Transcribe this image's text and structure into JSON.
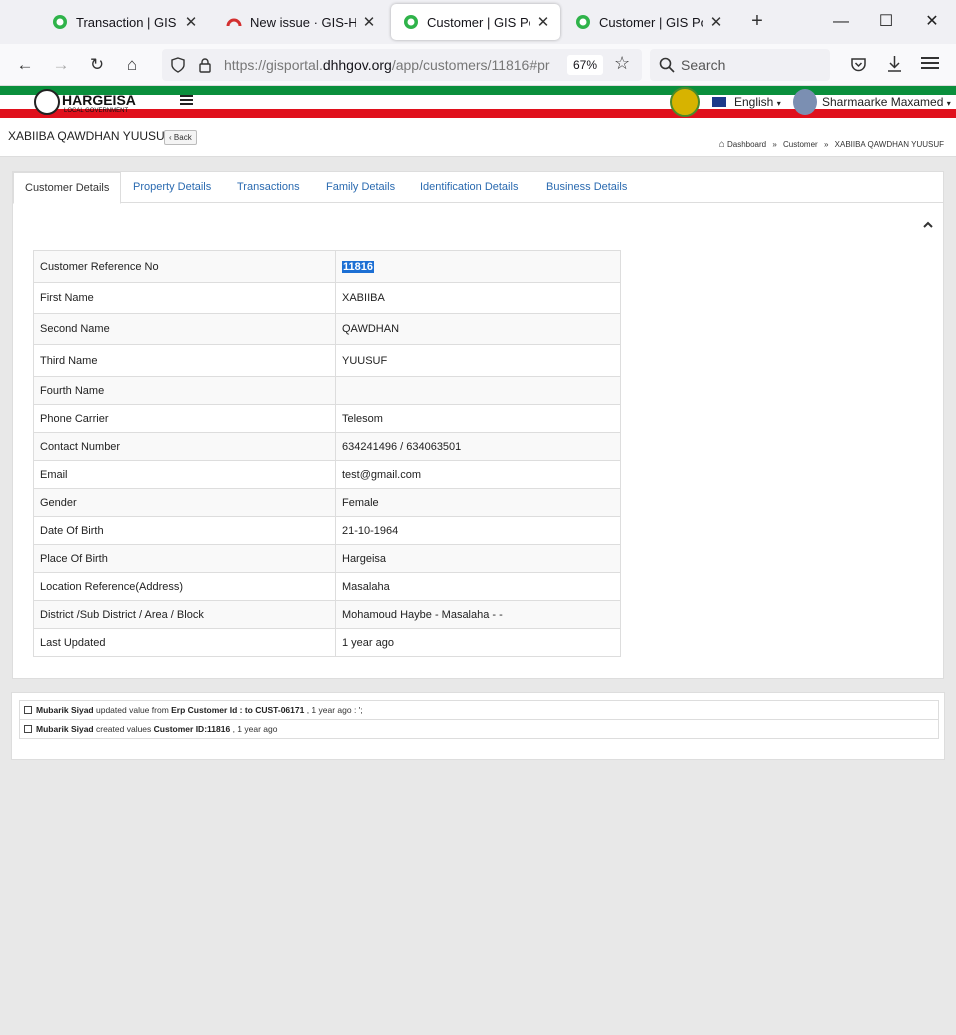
{
  "browser": {
    "tabs": [
      {
        "title": "Transaction | GIS Portal"
      },
      {
        "title": "New issue · GIS-Hargeisa"
      },
      {
        "title": "Customer | GIS Portal"
      },
      {
        "title": "Customer | GIS Portal"
      }
    ],
    "url_prefix": "https://gisportal.",
    "url_domain": "dhhgov.org",
    "url_path": "/app/customers/11816#pr",
    "zoom": "67%",
    "search_placeholder": "Search"
  },
  "header": {
    "logo_text": "HARGEISA",
    "logo_sub": "LOCAL GOVERNMENT",
    "language": "English",
    "user": "Sharmaarke Maxamed"
  },
  "page": {
    "title": "XABIIBA QAWDHAN YUUSUF",
    "back_label": "Back",
    "breadcrumbs": [
      "Dashboard",
      "Customer",
      "XABIIBA QAWDHAN YUUSUF"
    ]
  },
  "tabs": [
    {
      "label": "Customer Details"
    },
    {
      "label": "Property Details"
    },
    {
      "label": "Transactions"
    },
    {
      "label": "Family Details"
    },
    {
      "label": "Identification Details"
    },
    {
      "label": "Business Details"
    }
  ],
  "details": [
    {
      "label": "Customer Reference No",
      "value": "11816"
    },
    {
      "label": "First Name",
      "value": "XABIIBA"
    },
    {
      "label": "Second Name",
      "value": "QAWDHAN"
    },
    {
      "label": "Third Name",
      "value": "YUUSUF"
    },
    {
      "label": "Fourth Name",
      "value": ""
    },
    {
      "label": "Phone Carrier",
      "value": "Telesom"
    },
    {
      "label": "Contact Number",
      "value": "634241496 / 634063501"
    },
    {
      "label": "Email",
      "value": "test@gmail.com"
    },
    {
      "label": "Gender",
      "value": "Female"
    },
    {
      "label": "Date Of Birth",
      "value": "21-10-1964"
    },
    {
      "label": "Place Of Birth",
      "value": "Hargeisa"
    },
    {
      "label": "Location Reference(Address)",
      "value": "Masalaha"
    },
    {
      "label": "District /Sub District / Area / Block",
      "value": "Mohamoud Haybe - Masalaha - -"
    },
    {
      "label": "Last Updated",
      "value": "1 year ago"
    }
  ],
  "activity": [
    {
      "user": "Mubarik Siyad",
      "t1": " updated value from ",
      "b1": "Erp Customer Id : to CUST-06171",
      "t2": " , 1 year ago : ';"
    },
    {
      "user": "Mubarik Siyad",
      "t1": " created values ",
      "b1": "Customer ID:11816",
      "t2": " , 1 year ago"
    }
  ],
  "colors": {
    "accent_green": "#0a8f3c",
    "accent_red": "#e0101c",
    "link_blue": "#2a6ab0",
    "highlight": "#1c6fd4"
  }
}
